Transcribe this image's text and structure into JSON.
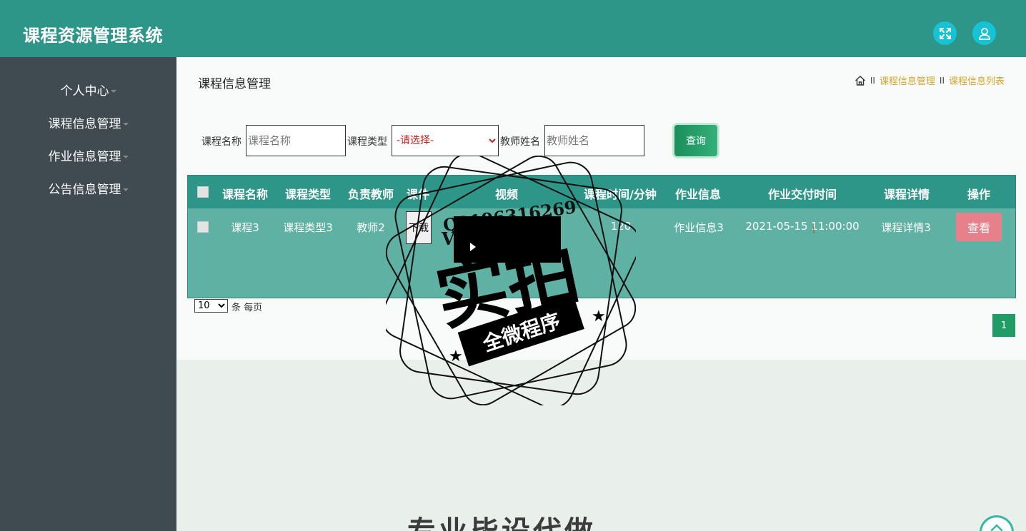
{
  "header": {
    "app_title": "课程资源管理系统",
    "fullscreen_icon": "fullscreen-icon",
    "user_icon": "user-icon"
  },
  "sidebar": {
    "items": [
      {
        "label": "个人中心"
      },
      {
        "label": "课程信息管理"
      },
      {
        "label": "作业信息管理"
      },
      {
        "label": "公告信息管理"
      }
    ]
  },
  "page": {
    "title": "课程信息管理"
  },
  "breadcrumb": {
    "home_icon": "home-icon",
    "sep": "II",
    "items": [
      "课程信息管理",
      "课程信息列表"
    ]
  },
  "search": {
    "course_name_label": "课程名称",
    "course_name_placeholder": "课程名称",
    "course_type_label": "课程类型",
    "course_type_selected": "-请选择-",
    "teacher_label": "教师姓名",
    "teacher_placeholder": "教师姓名",
    "query_label": "查询"
  },
  "table": {
    "headers": [
      "课程名称",
      "课程类型",
      "负责教师",
      "课件",
      "视频",
      "课程时间/分钟",
      "作业信息",
      "作业交付时间",
      "课程详情",
      "操作"
    ],
    "rows": [
      {
        "course_name": "课程3",
        "course_type": "课程类型3",
        "teacher": "教师2",
        "courseware_btn": "下载",
        "duration": "120",
        "homework": "作业信息3",
        "due_time": "2021-05-15 11:00:00",
        "detail": "课程详情3",
        "action": "查看"
      }
    ]
  },
  "pagination": {
    "page_size": "10",
    "page_size_label": "条 每页",
    "current_page": "1"
  },
  "overlay": {
    "watermark_line1": "Q2196316269",
    "watermark_line2": "V",
    "watermark_big": "实拍",
    "watermark_ribbon": "全微程序",
    "bottom_banner": "专业毕设代做"
  },
  "colors": {
    "topbar": "#2e9688",
    "sidebar": "#3f4a51",
    "table_body": "#5fb1a3",
    "accent_link": "#d4a72c",
    "view_button": "#e6808a",
    "query_button": "#229c66"
  }
}
